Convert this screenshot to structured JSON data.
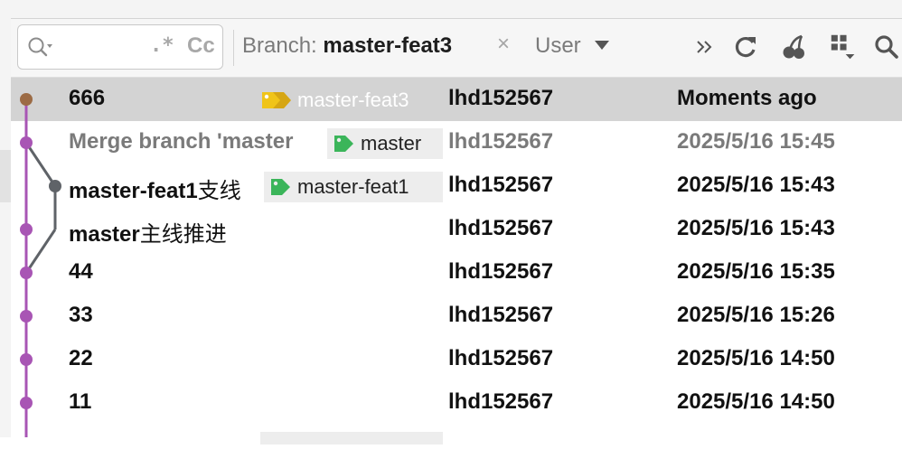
{
  "toolbar": {
    "search_value": "",
    "regex_label": ".*",
    "case_label": "Cc",
    "branch_label": "Branch:",
    "branch_value": "master-feat3",
    "clear_label": "×",
    "user_label": "User"
  },
  "colors": {
    "graph_purple": "#a855b4",
    "graph_grey": "#5f6368",
    "head_brown": "#9c6b45",
    "tag_green": "#3bb55a",
    "tag_yellow": "#f0c419",
    "selected_row": "#d3d3d3"
  },
  "icons": [
    "search-icon",
    "more-icon",
    "refresh-icon",
    "cherry-pick-icon",
    "layout-icon",
    "find-icon",
    "tag-icon"
  ],
  "commits": [
    {
      "subject": "666",
      "tag": "master-feat3",
      "author": "lhd152567",
      "date": "Moments ago",
      "selected": true
    },
    {
      "subject": "Merge branch 'master",
      "tag": "master",
      "author": "lhd152567",
      "date": "2025/5/16 15:45",
      "dim": true
    },
    {
      "subject": "master-feat1",
      "subject_cjk": "支线",
      "tag": "master-feat1",
      "author": "lhd152567",
      "date": "2025/5/16 15:43"
    },
    {
      "subject": "master",
      "subject_cjk": "主线推进",
      "author": "lhd152567",
      "date": "2025/5/16 15:43"
    },
    {
      "subject": "44",
      "author": "lhd152567",
      "date": "2025/5/16 15:35"
    },
    {
      "subject": "33",
      "author": "lhd152567",
      "date": "2025/5/16 15:26"
    },
    {
      "subject": "22",
      "author": "lhd152567",
      "date": "2025/5/16 14:50"
    },
    {
      "subject": "11",
      "author": "lhd152567",
      "date": "2025/5/16 14:50"
    }
  ]
}
